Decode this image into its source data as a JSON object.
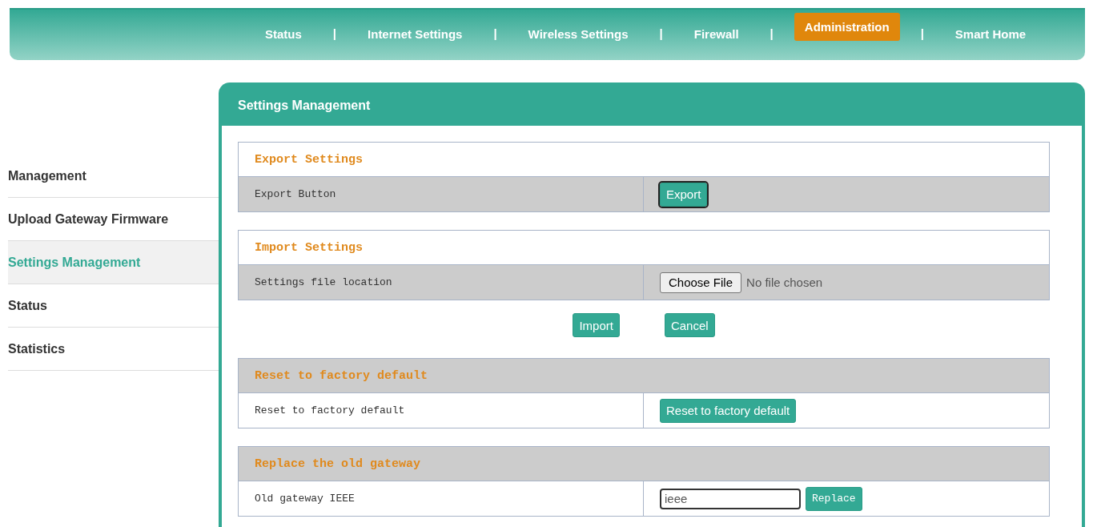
{
  "nav": [
    {
      "kind": "link",
      "label": "Status",
      "selected": false
    },
    {
      "kind": "separator",
      "label": "|"
    },
    {
      "kind": "link",
      "label": "Internet Settings",
      "selected": false
    },
    {
      "kind": "separator",
      "label": "|"
    },
    {
      "kind": "link",
      "label": "Wireless Settings",
      "selected": false
    },
    {
      "kind": "separator",
      "label": "|"
    },
    {
      "kind": "link",
      "label": "Firewall",
      "selected": false
    },
    {
      "kind": "separator",
      "label": "|"
    },
    {
      "kind": "link",
      "label": "Administration",
      "selected": true
    },
    {
      "kind": "separator",
      "label": "|"
    },
    {
      "kind": "link",
      "label": "Smart Home",
      "selected": false
    }
  ],
  "sidebar": {
    "items": [
      {
        "label": "Management",
        "selected": false
      },
      {
        "label": "Upload Gateway Firmware",
        "selected": false
      },
      {
        "label": "Settings Management",
        "selected": true
      },
      {
        "label": "Status",
        "selected": false
      },
      {
        "label": "Statistics",
        "selected": false
      }
    ]
  },
  "panel": {
    "title": "Settings Management",
    "sections": [
      {
        "title": "Export Settings",
        "kind": "light-header",
        "rows": [
          {
            "label": "Export Button",
            "kind": "button",
            "button": "Export"
          }
        ]
      },
      {
        "title": "Import Settings",
        "kind": "light-header",
        "rows": [
          {
            "label": "Settings file location",
            "kind": "file",
            "button": "Choose File",
            "status": "No file chosen"
          }
        ],
        "actions": [
          "Import",
          "Cancel"
        ]
      },
      {
        "title": "Reset to factory default",
        "kind": "shaded-header",
        "rows": [
          {
            "label": "Reset to factory default",
            "kind": "button",
            "button": "Reset to factory default"
          }
        ]
      },
      {
        "title": "Replace the old gateway",
        "kind": "shaded-header",
        "rows": [
          {
            "label": "Old gateway IEEE",
            "kind": "input",
            "value": "ieee",
            "button": "Replace"
          }
        ]
      }
    ]
  }
}
